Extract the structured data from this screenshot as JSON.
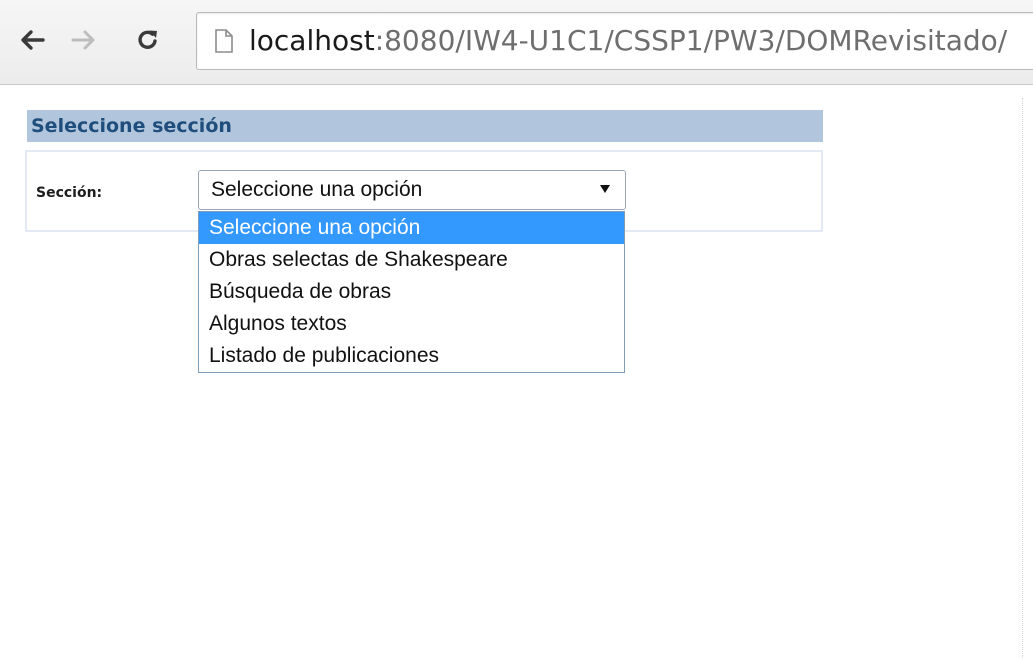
{
  "browser": {
    "url_host": "localhost",
    "url_rest": ":8080/IW4-U1C1/CSSP1/PW3/DOMRevisitado/",
    "icons": {
      "back": "back-arrow-icon",
      "forward": "forward-arrow-icon",
      "reload": "reload-icon",
      "page": "page-icon"
    }
  },
  "panel": {
    "title": "Seleccione sección",
    "field_label": "Sección:",
    "select": {
      "value": "Seleccione una opción",
      "options": [
        "Seleccione una opción",
        "Obras selectas de Shakespeare",
        "Búsqueda de obras",
        "Algunos textos",
        "Listado de publicaciones"
      ],
      "highlighted_index": 0
    }
  },
  "colors": {
    "title_bar": "#b1c5dd",
    "title_text": "#1f4d7c",
    "highlight": "#3399ff"
  }
}
